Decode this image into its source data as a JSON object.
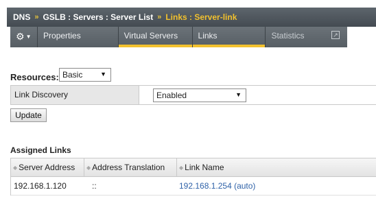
{
  "breadcrumb": {
    "root": "DNS",
    "sep1": "»",
    "path": "GSLB : Servers : Server List",
    "sep2": "»",
    "current": "Links : Server-link"
  },
  "tabs": {
    "properties": "Properties",
    "virtual_servers": "Virtual Servers",
    "links": "Links",
    "statistics": "Statistics",
    "gear_icon": "⚙",
    "caret_icon": "▼",
    "popout_icon": "↗"
  },
  "resources": {
    "label": "Resources:",
    "value": "Basic",
    "arrow": "▼"
  },
  "link_discovery": {
    "label": "Link Discovery",
    "value": "Enabled",
    "arrow": "▼"
  },
  "update_button": "Update",
  "assigned_links": {
    "title": "Assigned Links",
    "sort_icon": "◆",
    "columns": [
      "Server Address",
      "Address Translation",
      "Link Name"
    ],
    "rows": [
      [
        "192.168.1.120",
        "::",
        "192.168.1.254 (auto)"
      ]
    ]
  },
  "colors": {
    "accent": "#f2c12e",
    "header_bg": "#4f565d",
    "link": "#2f62a8"
  }
}
